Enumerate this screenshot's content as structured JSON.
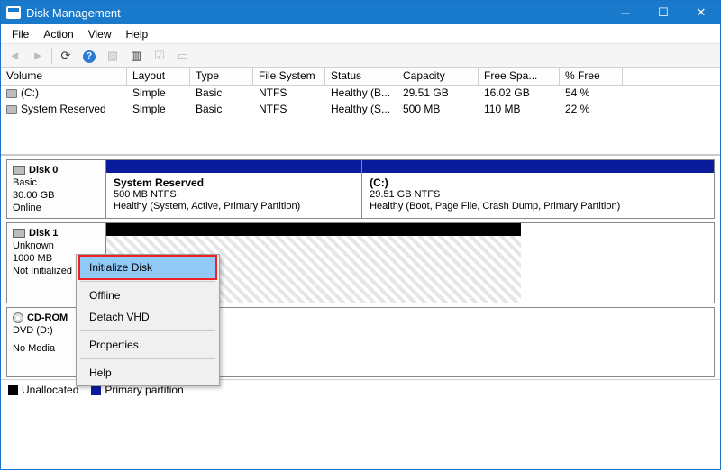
{
  "window": {
    "title": "Disk Management"
  },
  "menu": {
    "file": "File",
    "action": "Action",
    "view": "View",
    "help": "Help"
  },
  "columns": [
    "Volume",
    "Layout",
    "Type",
    "File System",
    "Status",
    "Capacity",
    "Free Spa...",
    "% Free"
  ],
  "volumes": [
    {
      "name": "(C:)",
      "layout": "Simple",
      "type": "Basic",
      "fs": "NTFS",
      "status": "Healthy (B...",
      "capacity": "29.51 GB",
      "free": "16.02 GB",
      "pct": "54 %"
    },
    {
      "name": "System Reserved",
      "layout": "Simple",
      "type": "Basic",
      "fs": "NTFS",
      "status": "Healthy (S...",
      "capacity": "500 MB",
      "free": "110 MB",
      "pct": "22 %"
    }
  ],
  "disks": {
    "disk0": {
      "name": "Disk 0",
      "type": "Basic",
      "size": "30.00 GB",
      "state": "Online",
      "p0": {
        "title": "System Reserved",
        "line1": "500 MB NTFS",
        "line2": "Healthy (System, Active, Primary Partition)"
      },
      "p1": {
        "title": "(C:)",
        "line1": "29.51 GB NTFS",
        "line2": "Healthy (Boot, Page File, Crash Dump, Primary Partition)"
      }
    },
    "disk1": {
      "name": "Disk 1",
      "type": "Unknown",
      "size": "1000 MB",
      "state": "Not Initialized"
    },
    "cdrom": {
      "name": "CD-ROM",
      "drive": "DVD (D:)",
      "media": "No Media"
    }
  },
  "legend": {
    "unalloc": "Unallocated",
    "primary": "Primary partition"
  },
  "context_menu": {
    "initialize": "Initialize Disk",
    "offline": "Offline",
    "detach": "Detach VHD",
    "properties": "Properties",
    "help": "Help"
  },
  "colors": {
    "titlebar": "#1979ca",
    "primary_bar": "#0a1c9c",
    "unalloc_bar": "#000000",
    "ctx_highlight": "#91c9f7",
    "ctx_highlight_border": "#e22020"
  }
}
